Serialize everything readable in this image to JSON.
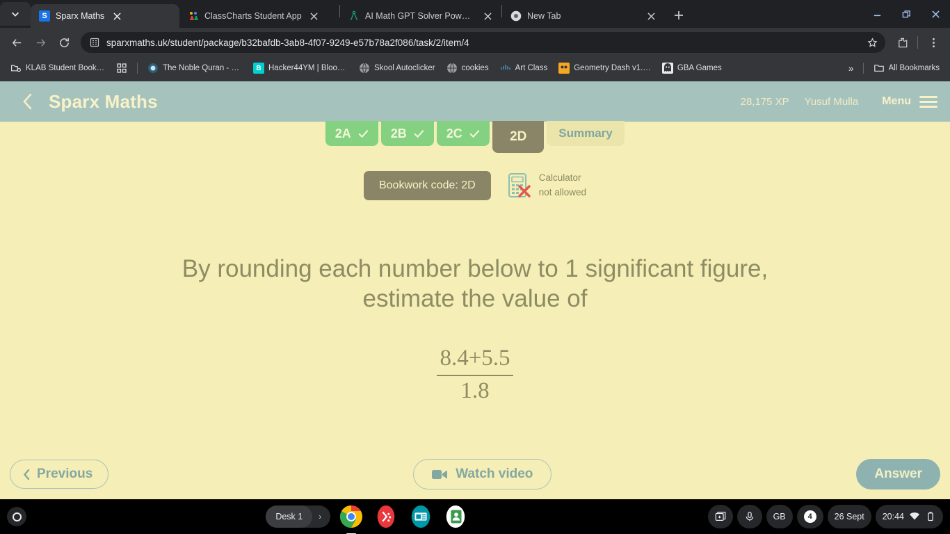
{
  "browser": {
    "tabs": [
      {
        "title": "Sparx Maths",
        "favicon": "sparx-s-icon",
        "active": true
      },
      {
        "title": "ClassCharts Student App",
        "favicon": "classcharts-icon",
        "active": false
      },
      {
        "title": "AI Math GPT Solver Powered by",
        "favicon": "compass-icon",
        "active": false
      },
      {
        "title": "New Tab",
        "favicon": "chrome-icon",
        "active": false
      }
    ],
    "new_tab_label": "+",
    "window_controls": {
      "minimize": "minimize-icon",
      "maximize": "restore-icon",
      "close": "close-icon"
    },
    "toolbar": {
      "back": "back-arrow-icon",
      "forward": "forward-arrow-icon",
      "reload": "reload-icon",
      "url": "sparxmaths.uk/student/package/b32bafdb-3ab8-4f07-9249-e57b78a2f086/task/2/item/4",
      "url_placeholder": "Search Google or type a URL",
      "bookmark_star": "star-icon",
      "extensions": "puzzle-piece-icon",
      "menu": "three-dot-menu-icon"
    },
    "bookmarks": [
      {
        "label": "KLAB Student Bookmarks",
        "icon": "folder-gear-icon"
      },
      {
        "label": "",
        "icon": "apps-grid-icon"
      },
      {
        "label": "The Noble Quran - Q…",
        "icon": "quran-icon"
      },
      {
        "label": "Hacker44YM | Blook…",
        "icon": "blooket-b-icon"
      },
      {
        "label": "Skool Autoclicker",
        "icon": "globe-icon"
      },
      {
        "label": "cookies",
        "icon": "globe-icon"
      },
      {
        "label": "Art Class",
        "icon": "cisco-icon"
      },
      {
        "label": "Geometry Dash v1.…",
        "icon": "geometry-dash-icon"
      },
      {
        "label": "GBA Games",
        "icon": "ghost-icon"
      }
    ],
    "bookmarks_overflow": "»",
    "all_bookmarks_label": "All Bookmarks",
    "all_bookmarks_icon": "folder-icon"
  },
  "sparx": {
    "back_icon": "chevron-left-icon",
    "title": "Sparx Maths",
    "xp": "28,175 XP",
    "user": "Yusuf Mulla",
    "menu_label": "Menu",
    "menu_icon": "hamburger-icon",
    "task_tabs": [
      {
        "label": "2A",
        "state": "done",
        "icon": "check-icon"
      },
      {
        "label": "2B",
        "state": "done",
        "icon": "check-icon"
      },
      {
        "label": "2C",
        "state": "done",
        "icon": "check-icon"
      },
      {
        "label": "2D",
        "state": "current",
        "icon": ""
      },
      {
        "label": "Summary",
        "state": "summary",
        "icon": ""
      }
    ],
    "bookwork_code": "Bookwork code: 2D",
    "calculator": {
      "icon": "calculator-not-allowed-icon",
      "line1": "Calculator",
      "line2": "not allowed"
    },
    "question": {
      "line1": "By rounding each number below to 1 significant figure,",
      "line2": "estimate the value of",
      "fraction_numerator": "8.4+5.5",
      "fraction_denominator": "1.8"
    },
    "buttons": {
      "previous": "Previous",
      "previous_icon": "chevron-left-icon",
      "watch_video": "Watch video",
      "watch_video_icon": "video-camera-icon",
      "answer": "Answer"
    },
    "colors": {
      "page_bg": "#f5eeb6",
      "header_bg": "#a6c2bd",
      "accent_text": "#8d8c63",
      "done_tab": "#84d181",
      "current_tab": "#8b8567",
      "answer_button": "#8db2b0"
    }
  },
  "shelf": {
    "launcher_icon": "launcher-icon",
    "desk_label": "Desk 1",
    "desk_arrow": "›",
    "apps": [
      {
        "name": "chrome-icon",
        "active": true
      },
      {
        "name": "kahoot-icon",
        "active": false
      },
      {
        "name": "news-icon",
        "active": false
      },
      {
        "name": "contacts-icon",
        "active": false
      }
    ],
    "tray": {
      "screen_capture_icon": "screen-capture-icon",
      "microphone_icon": "microphone-icon",
      "keyboard_layout": "GB",
      "notification_count": "4",
      "date": "26 Sept",
      "time": "20:44",
      "wifi_icon": "wifi-icon",
      "battery_icon": "battery-icon"
    }
  }
}
